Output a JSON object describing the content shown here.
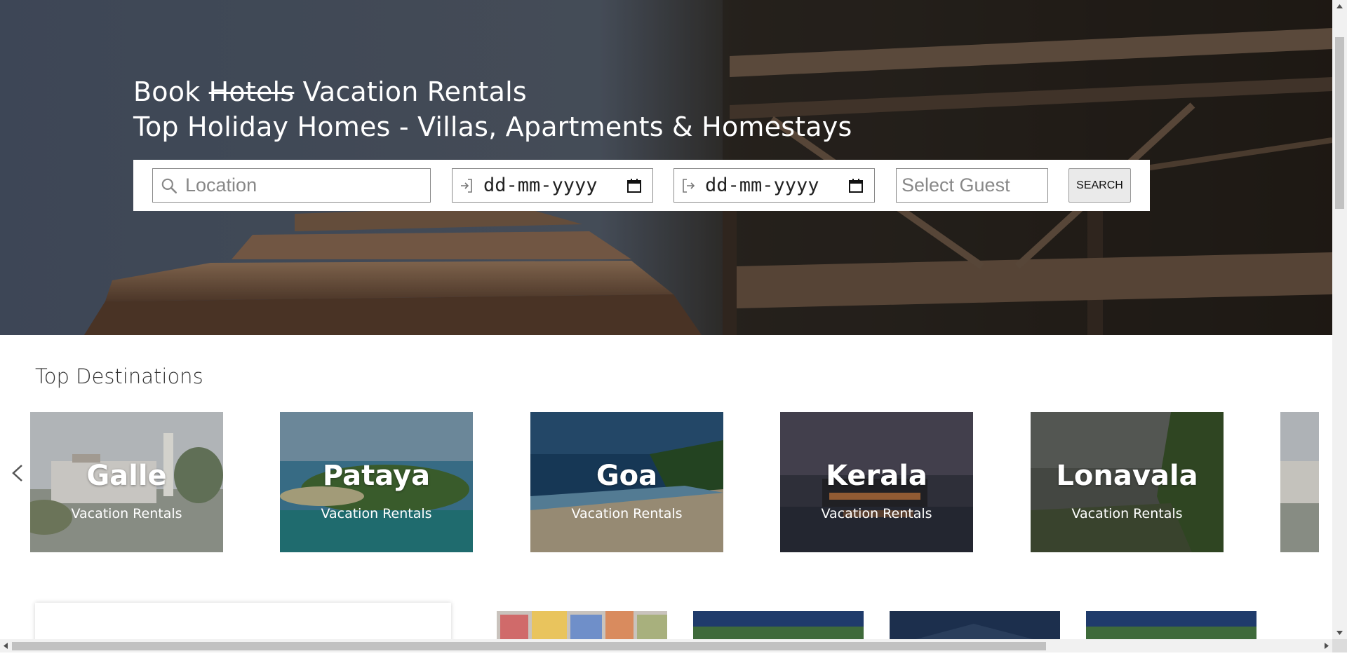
{
  "hero": {
    "title_prefix": "Book",
    "title_struck": "Hotels",
    "title_suffix": "Vacation Rentals",
    "subtitle": "Top Holiday Homes - Villas, Apartments & Homestays"
  },
  "search": {
    "location_placeholder": "Location",
    "checkin_value": "dd-mm-yyyy",
    "checkout_value": "dd-mm-yyyy",
    "guest_placeholder": "Select Guest",
    "button_label": "SEARCH"
  },
  "destinations": {
    "title": "Top Destinations",
    "items": [
      {
        "name": "Galle",
        "subtitle": "Vacation Rentals"
      },
      {
        "name": "Pataya",
        "subtitle": "Vacation Rentals"
      },
      {
        "name": "Goa",
        "subtitle": "Vacation Rentals"
      },
      {
        "name": "Kerala",
        "subtitle": "Vacation Rentals"
      },
      {
        "name": "Lonavala",
        "subtitle": "Vacation Rentals"
      }
    ]
  },
  "icons": {
    "location": "search-icon",
    "checkin": "login-icon",
    "checkout": "logout-icon",
    "calendar": "calendar-icon",
    "prev": "chevron-left-icon"
  },
  "colors": {
    "hero_overlay_text": "#ffffff",
    "search_button_bg": "#eaeaea"
  }
}
